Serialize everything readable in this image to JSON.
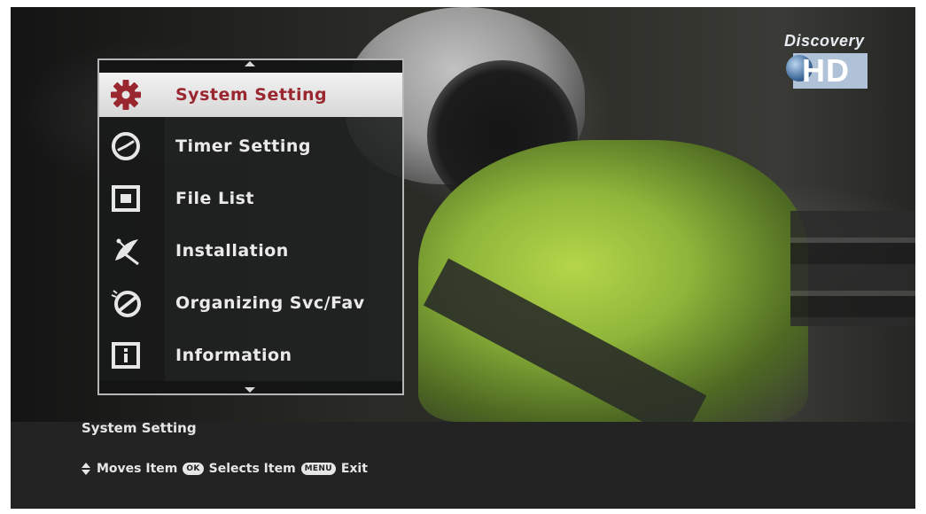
{
  "channel_logo": {
    "text": "Discovery",
    "badge": "HD"
  },
  "menu": {
    "items": [
      {
        "label": "System Setting",
        "icon": "gear-icon",
        "selected": true
      },
      {
        "label": "Timer Setting",
        "icon": "clock-icon",
        "selected": false
      },
      {
        "label": "File List",
        "icon": "file-list-icon",
        "selected": false
      },
      {
        "label": "Installation",
        "icon": "satellite-dish-icon",
        "selected": false
      },
      {
        "label": "Organizing Svc/Fav",
        "icon": "organize-icon",
        "selected": false
      },
      {
        "label": "Information",
        "icon": "info-icon",
        "selected": false
      }
    ]
  },
  "infobar": {
    "title": "System Setting",
    "hints": {
      "moves": "Moves Item",
      "ok_key": "OK",
      "selects": "Selects Item",
      "menu_key": "MENU",
      "exit": "Exit"
    }
  },
  "colors": {
    "selected_text": "#9a2630",
    "accent_icon": "#9a2630",
    "menu_border": "#b6b6b6",
    "infobar_bg": "#232323"
  }
}
